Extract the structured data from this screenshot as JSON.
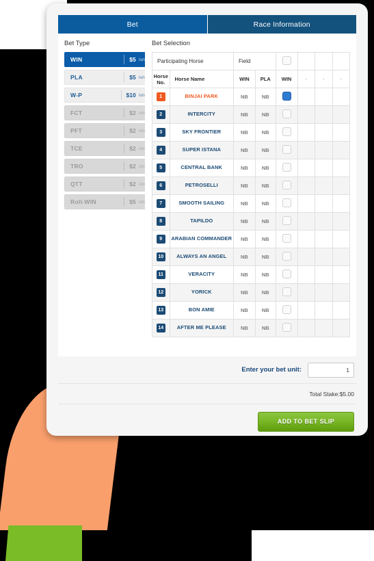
{
  "tabs": [
    {
      "label": "Bet",
      "active": true
    },
    {
      "label": "Race Information",
      "active": false
    }
  ],
  "bet_type": {
    "title": "Bet Type",
    "items": [
      {
        "code": "WIN",
        "price": "$5",
        "unit": "/unit",
        "state": "selected"
      },
      {
        "code": "PLA",
        "price": "$5",
        "unit": "/unit",
        "state": "available"
      },
      {
        "code": "W-P",
        "price": "$10",
        "unit": "/unit",
        "state": "available"
      },
      {
        "code": "FCT",
        "price": "$2",
        "unit": "/unit",
        "state": "disabled"
      },
      {
        "code": "PFT",
        "price": "$2",
        "unit": "/unit",
        "state": "disabled"
      },
      {
        "code": "TCE",
        "price": "$2",
        "unit": "/unit",
        "state": "disabled"
      },
      {
        "code": "TRO",
        "price": "$2",
        "unit": "/unit",
        "state": "disabled"
      },
      {
        "code": "QTT",
        "price": "$2",
        "unit": "/unit",
        "state": "disabled"
      },
      {
        "code": "Roll-WIN",
        "price": "$5",
        "unit": "/unit",
        "state": "disabled"
      }
    ]
  },
  "bet_selection": {
    "title": "Bet Selection",
    "group_headers": {
      "participating_horse": "Participating Horse",
      "field": "Field",
      "field_checkbox_checked": false
    },
    "columns": {
      "horse_no": "Horse No.",
      "horse_name": "Horse Name",
      "win": "WIN",
      "pla": "PLA",
      "field_win": "WIN",
      "extra1": "-",
      "extra2": "-",
      "extra3": "-"
    },
    "rows": [
      {
        "no": "1",
        "name": "BINJAI PARK",
        "win": "NB",
        "pla": "NB",
        "checked": true,
        "selected": true
      },
      {
        "no": "2",
        "name": "INTERCITY",
        "win": "NB",
        "pla": "NB",
        "checked": false,
        "selected": false
      },
      {
        "no": "3",
        "name": "SKY FRONTIER",
        "win": "NB",
        "pla": "NB",
        "checked": false,
        "selected": false
      },
      {
        "no": "4",
        "name": "SUPER ISTANA",
        "win": "NB",
        "pla": "NB",
        "checked": false,
        "selected": false
      },
      {
        "no": "5",
        "name": "CENTRAL BANK",
        "win": "NB",
        "pla": "NB",
        "checked": false,
        "selected": false
      },
      {
        "no": "6",
        "name": "PETROSELLI",
        "win": "NB",
        "pla": "NB",
        "checked": false,
        "selected": false
      },
      {
        "no": "7",
        "name": "SMOOTH SAILING",
        "win": "NB",
        "pla": "NB",
        "checked": false,
        "selected": false
      },
      {
        "no": "8",
        "name": "TAPILDO",
        "win": "NB",
        "pla": "NB",
        "checked": false,
        "selected": false
      },
      {
        "no": "9",
        "name": "ARABIAN COMMANDER",
        "win": "NB",
        "pla": "NB",
        "checked": false,
        "selected": false
      },
      {
        "no": "10",
        "name": "ALWAYS AN ANGEL",
        "win": "NB",
        "pla": "NB",
        "checked": false,
        "selected": false
      },
      {
        "no": "11",
        "name": "VERACITY",
        "win": "NB",
        "pla": "NB",
        "checked": false,
        "selected": false
      },
      {
        "no": "12",
        "name": "YORICK",
        "win": "NB",
        "pla": "NB",
        "checked": false,
        "selected": false
      },
      {
        "no": "13",
        "name": "BON AMIE",
        "win": "NB",
        "pla": "NB",
        "checked": false,
        "selected": false
      },
      {
        "no": "14",
        "name": "AFTER ME PLEASE",
        "win": "NB",
        "pla": "NB",
        "checked": false,
        "selected": false
      }
    ]
  },
  "footer": {
    "unit_label": "Enter your bet unit:",
    "unit_value": "1",
    "unit_placeholder": "1",
    "total_stake": "Total Stake:$5.00",
    "add_button": "ADD TO BET SLIP"
  },
  "colors": {
    "tab_active": "#0a5c9e",
    "tab_inactive": "#14527e",
    "accent_blue": "#1b4a74",
    "selected_orange": "#ef5a20",
    "button_green": "#7ab828",
    "checkbox_on": "#2f7bd0"
  }
}
